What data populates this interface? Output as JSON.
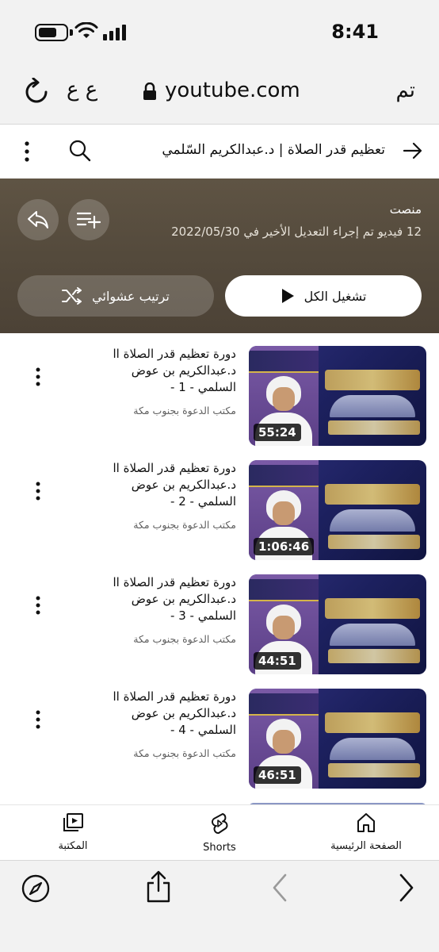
{
  "status_bar": {
    "time": "8:41"
  },
  "browser": {
    "url": "youtube.com",
    "aa_label": "ع ع",
    "done_label": "تم"
  },
  "header": {
    "title": "تعظيم قدر الصلاة | د.عبدالكريم السّلمي"
  },
  "playlist": {
    "creator": "منصت",
    "meta": "12 فيديو   تم إجراء التعديل الأخير في 2022/05/30",
    "play_all_label": "تشغيل الكل",
    "shuffle_label": "ترتيب عشوائي"
  },
  "videos": [
    {
      "title": "دورة تعظيم قدر الصلاة اا د.عبدالكريم بن عوض السلمي - 1 -",
      "channel": "مكتب الدعوة بجنوب مكة",
      "duration": "55:24"
    },
    {
      "title": "دورة تعظيم قدر الصلاة اا د.عبدالكريم بن عوض السلمي - 2 -",
      "channel": "مكتب الدعوة بجنوب مكة",
      "duration": "1:06:46"
    },
    {
      "title": "دورة تعظيم قدر الصلاة اا د.عبدالكريم بن عوض السلمي - 3 -",
      "channel": "مكتب الدعوة بجنوب مكة",
      "duration": "44:51"
    },
    {
      "title": "دورة تعظيم قدر الصلاة اا د.عبدالكريم بن عوض السلمي - 4 -",
      "channel": "مكتب الدعوة بجنوب مكة",
      "duration": "46:51"
    }
  ],
  "bottom_nav": {
    "home_label": "الصفحة الرئيسية",
    "shorts_label": "Shorts",
    "library_label": "المكتبة"
  },
  "icons": {
    "back": "arrow-right-icon",
    "search": "search-icon",
    "more": "more-vert-icon",
    "add_to_queue": "playlist-add-icon",
    "share": "share-icon",
    "play": "play-icon",
    "shuffle": "shuffle-icon",
    "home": "home-icon",
    "shorts": "shorts-icon",
    "library": "library-icon",
    "compass": "compass-icon",
    "share_sheet": "share-sheet-icon",
    "browser_back": "chevron-left-icon",
    "browser_forward": "chevron-right-icon"
  }
}
